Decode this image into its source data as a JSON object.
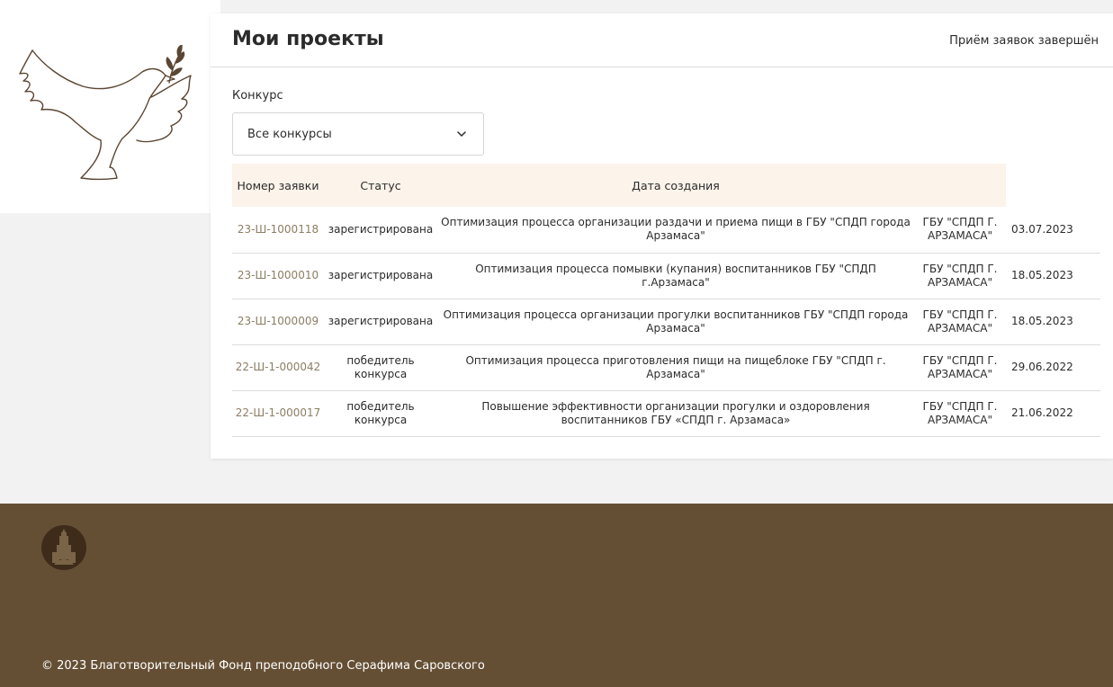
{
  "header": {
    "title": "Мои проекты",
    "status": "Приём заявок завершён"
  },
  "filter": {
    "label": "Конкурс",
    "selected": "Все конкурсы"
  },
  "table": {
    "columns": [
      "Номер заявки",
      "Статус",
      "Дата создания"
    ],
    "rows": [
      {
        "number": "23-Ш-1000118",
        "status": "зарегистрирована",
        "title": "Оптимизация процесса организации раздачи и приема пищи в ГБУ \"СПДП города Арзамаса\"",
        "org": "ГБУ \"СПДП Г. АРЗАМАСА\"",
        "date": "03.07.2023"
      },
      {
        "number": "23-Ш-1000010",
        "status": "зарегистрирована",
        "title": "Оптимизация процесса помывки (купания) воспитанников ГБУ \"СПДП г.Арзамаса\"",
        "org": "ГБУ \"СПДП Г. АРЗАМАСА\"",
        "date": "18.05.2023"
      },
      {
        "number": "23-Ш-1000009",
        "status": "зарегистрирована",
        "title": "Оптимизация процесса организации прогулки воспитанников ГБУ \"СПДП города Арзамаса\"",
        "org": "ГБУ \"СПДП Г. АРЗАМАСА\"",
        "date": "18.05.2023"
      },
      {
        "number": "22-Ш-1-000042",
        "status": "победитель конкурса",
        "title": "Оптимизация процесса приготовления пищи на пищеблоке ГБУ \"СПДП г. Арзамаса\"",
        "org": "ГБУ \"СПДП Г. АРЗАМАСА\"",
        "date": "29.06.2022"
      },
      {
        "number": "22-Ш-1-000017",
        "status": "победитель конкурса",
        "title": "Повышение эффективности организации прогулки и оздоровления воспитанников ГБУ «СПДП г. Арзамаса»",
        "org": "ГБУ \"СПДП Г. АРЗАМАСА\"",
        "date": "21.06.2022"
      }
    ]
  },
  "footer": {
    "copyright": "© 2023 Благотворительный Фонд преподобного Серафима Саровского"
  },
  "colors": {
    "accent_brown": "#654f34",
    "header_bg": "#fcf3ea",
    "link_number": "#8c7e64"
  },
  "icons": [
    "dove-logo-icon",
    "chevron-down-icon",
    "foundation-emblem-icon"
  ]
}
